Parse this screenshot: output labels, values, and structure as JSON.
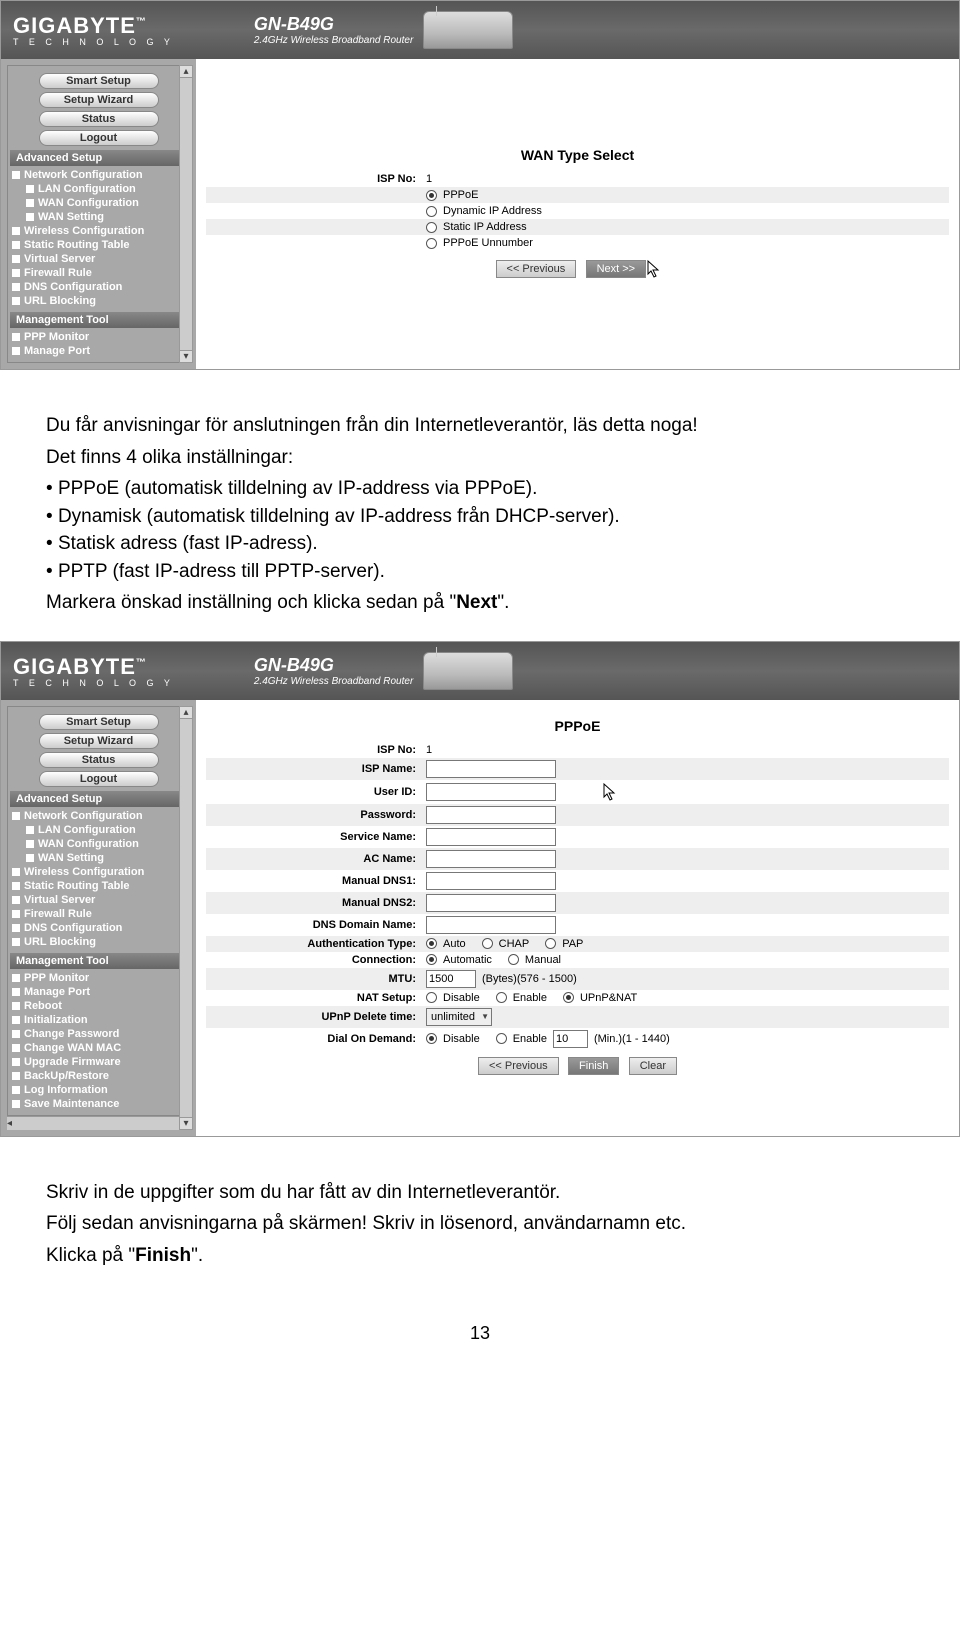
{
  "brand": {
    "name": "GIGABYTE",
    "sub": "T E C H N O L O G Y"
  },
  "model": {
    "name": "GN-B49G",
    "sub": "2.4GHz Wireless Broadband Router"
  },
  "sidebar": {
    "pills": [
      "Smart Setup",
      "Setup Wizard",
      "Status",
      "Logout"
    ],
    "sections": [
      {
        "title": "Advanced Setup",
        "items": [
          "Network Configuration",
          "LAN Configuration",
          "WAN Configuration",
          "WAN Setting",
          "Wireless Configuration",
          "Static Routing Table",
          "Virtual Server",
          "Firewall Rule",
          "DNS Configuration",
          "URL Blocking"
        ],
        "subs": {
          "0": false,
          "1": true,
          "2": true,
          "3": true,
          "4": false,
          "5": false,
          "6": false,
          "7": false,
          "8": false,
          "9": false
        }
      },
      {
        "title": "Management Tool",
        "items": [
          "PPP Monitor",
          "Manage Port"
        ]
      }
    ],
    "sections2": [
      {
        "title": "Advanced Setup",
        "items": [
          "Network Configuration",
          "LAN Configuration",
          "WAN Configuration",
          "WAN Setting",
          "Wireless Configuration",
          "Static Routing Table",
          "Virtual Server",
          "Firewall Rule",
          "DNS Configuration",
          "URL Blocking"
        ],
        "subs": {
          "0": false,
          "1": true,
          "2": true,
          "3": true,
          "4": false,
          "5": false,
          "6": false,
          "7": false,
          "8": false,
          "9": false
        }
      },
      {
        "title": "Management Tool",
        "items": [
          "PPP Monitor",
          "Manage Port",
          "Reboot",
          "Initialization",
          "Change Password",
          "Change WAN MAC",
          "Upgrade Firmware",
          "BackUp/Restore",
          "Log Information",
          "Save Maintenance"
        ]
      }
    ]
  },
  "screen1": {
    "title": "WAN Type Select",
    "isp_label": "ISP No:",
    "isp_value": "1",
    "options": [
      "PPPoE",
      "Dynamic IP Address",
      "Static IP Address",
      "PPPoE Unnumber"
    ],
    "selected": 0,
    "prev": "<< Previous",
    "next": "Next >>"
  },
  "doc1": {
    "p1": "Du får anvisningar för anslutningen från din Internetleverantör, läs detta noga!",
    "p2": "Det finns 4 olika inställningar:",
    "b1": "PPPoE (automatisk tilldelning av IP-address via PPPoE).",
    "b2": "Dynamisk (automatisk tilldelning av IP-address från DHCP-server).",
    "b3": "Statisk adress (fast IP-adress).",
    "b4": "PPTP (fast IP-adress till PPTP-server).",
    "p3a": "Markera önskad inställning och klicka sedan på \"",
    "p3b": "Next",
    "p3c": "\"."
  },
  "screen2": {
    "title": "PPPoE",
    "rows": {
      "isp_no": "ISP No:",
      "isp_no_val": "1",
      "isp_name": "ISP Name:",
      "user_id": "User ID:",
      "password": "Password:",
      "service_name": "Service Name:",
      "ac_name": "AC Name:",
      "dns1": "Manual DNS1:",
      "dns2": "Manual DNS2:",
      "dns_domain": "DNS Domain Name:",
      "auth_type": "Authentication Type:",
      "connection": "Connection:",
      "mtu": "MTU:",
      "mtu_val": "1500",
      "mtu_hint": "(Bytes)(576 - 1500)",
      "nat": "NAT Setup:",
      "upnp_del": "UPnP Delete time:",
      "upnp_del_val": "unlimited",
      "dod": "Dial On Demand:",
      "dod_val": "10",
      "dod_hint": "(Min.)(1 - 1440)"
    },
    "auth_opts": [
      "Auto",
      "CHAP",
      "PAP"
    ],
    "auth_sel": 0,
    "conn_opts": [
      "Automatic",
      "Manual"
    ],
    "conn_sel": 0,
    "nat_opts": [
      "Disable",
      "Enable",
      "UPnP&NAT"
    ],
    "nat_sel": 2,
    "dod_opts": [
      "Disable",
      "Enable"
    ],
    "dod_sel": 0,
    "prev": "<< Previous",
    "finish": "Finish",
    "clear": "Clear"
  },
  "doc2": {
    "p1": "Skriv in de uppgifter som du har fått av din Internetleverantör.",
    "p2": "Följ sedan anvisningarna på skärmen! Skriv in lösenord, användarnamn etc.",
    "p3a": "Klicka på \"",
    "p3b": "Finish",
    "p3c": "\"."
  },
  "page_number": "13"
}
